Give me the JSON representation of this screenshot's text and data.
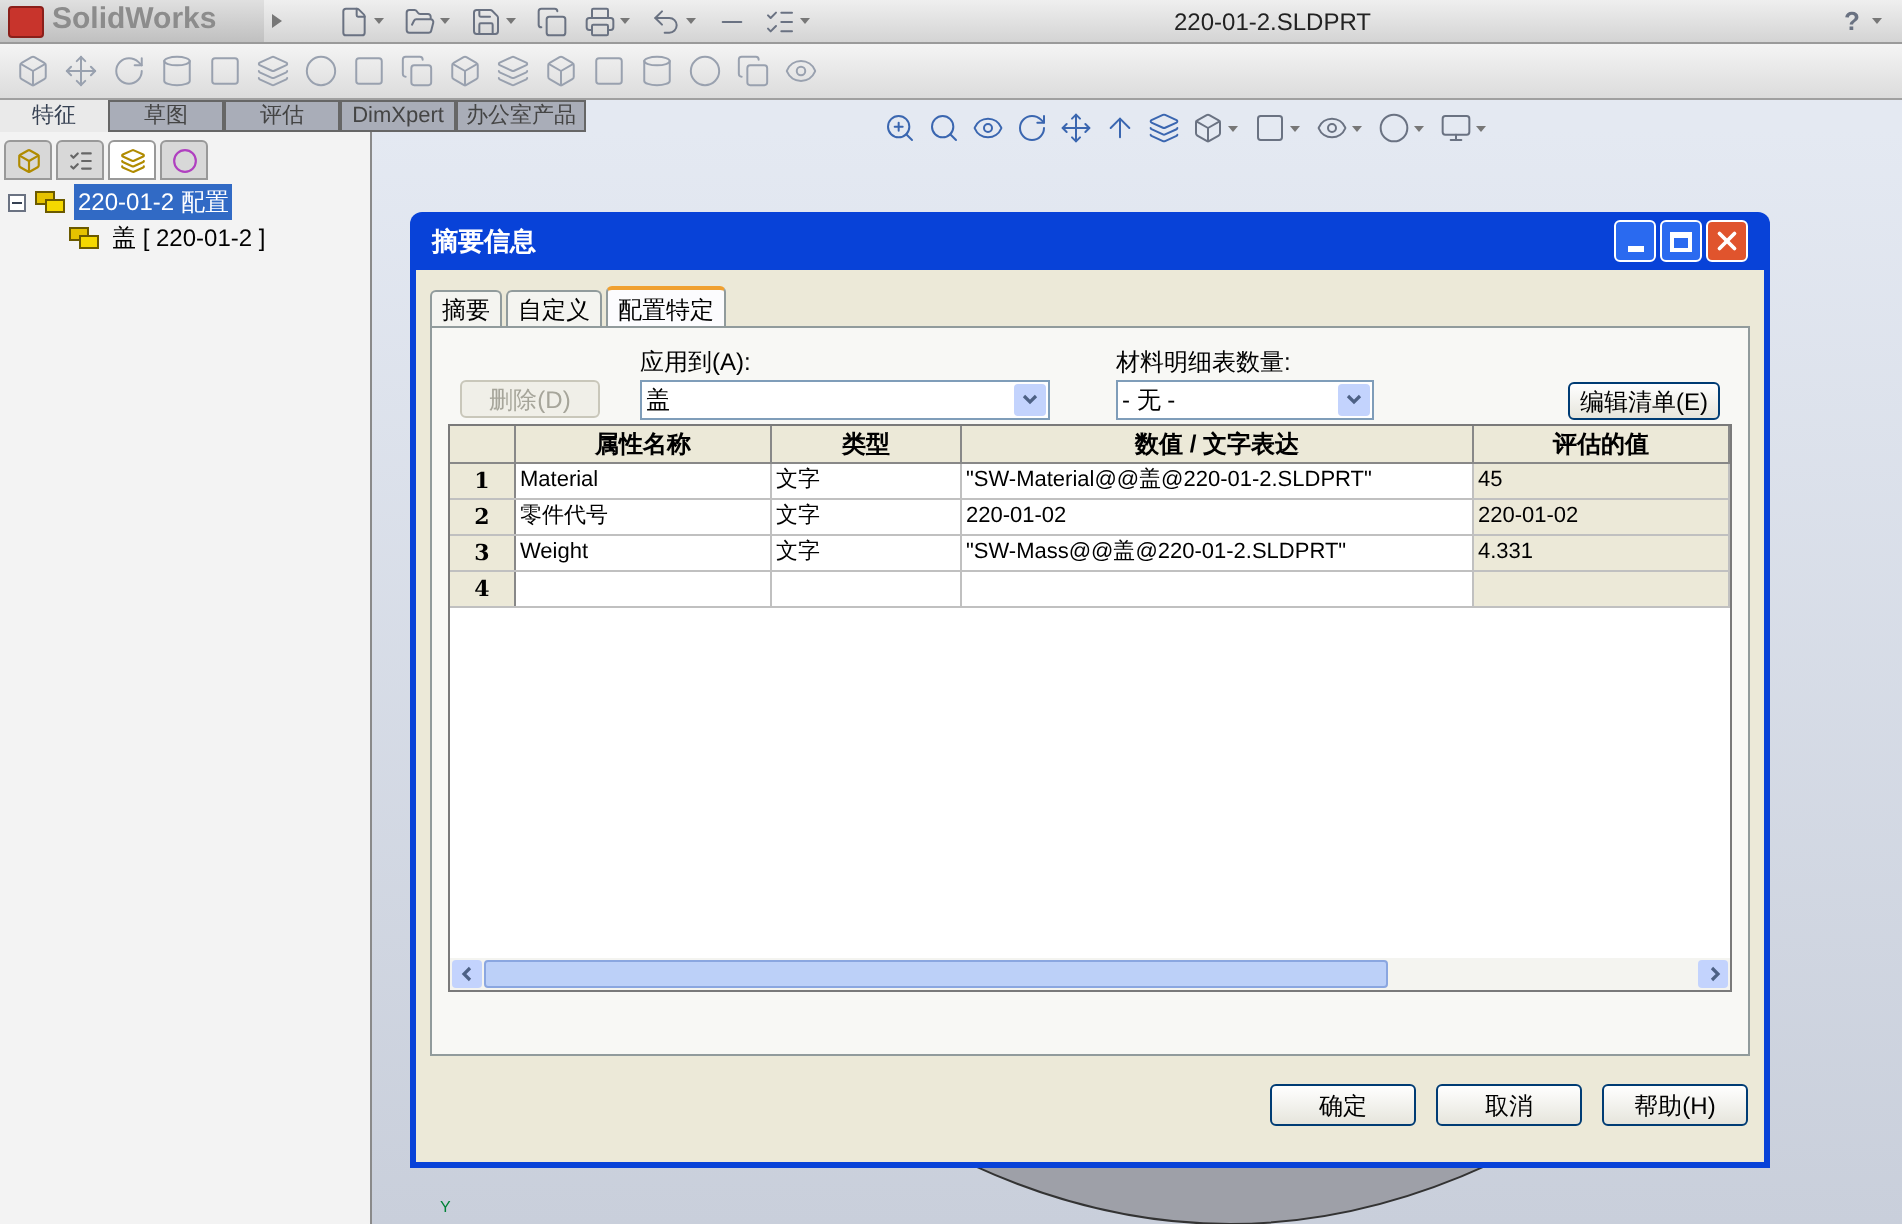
{
  "app": {
    "logo_text": "SolidWorks",
    "document_title": "220-01-2.SLDPRT",
    "help_label": "?"
  },
  "command_tabs": [
    {
      "label": "特征",
      "selected": true
    },
    {
      "label": "草图",
      "selected": false
    },
    {
      "label": "评估",
      "selected": false
    },
    {
      "label": "DimXpert",
      "selected": false
    },
    {
      "label": "办公室产品",
      "selected": false
    }
  ],
  "panel_tabs": [
    {
      "kind": "feature",
      "selected": false
    },
    {
      "kind": "property",
      "selected": false
    },
    {
      "kind": "config",
      "selected": true
    },
    {
      "kind": "display",
      "selected": false
    }
  ],
  "tree": [
    {
      "label": "220-01-2 配置",
      "selected": true,
      "expanded": true,
      "children": [
        {
          "label": "盖 [ 220-01-2 ]",
          "selected": false
        }
      ]
    }
  ],
  "dialog": {
    "title": "摘要信息",
    "tabs": [
      {
        "label": "摘要",
        "selected": false
      },
      {
        "label": "自定义",
        "selected": false
      },
      {
        "label": "配置特定",
        "selected": true
      }
    ],
    "delete_button": {
      "label": "删除(D)",
      "disabled": true
    },
    "apply_to": {
      "label": "应用到(A):",
      "value": "盖"
    },
    "bom_quantity": {
      "label": "材料明细表数量:",
      "value": "- 无 -"
    },
    "edit_list_button": "编辑清单(E)",
    "table": {
      "columns": [
        "属性名称",
        "类型",
        "数值 / 文字表达",
        "评估的值"
      ],
      "rows": [
        {
          "number": "1",
          "cells": [
            "Material",
            "文字",
            "\"SW-Material@@盖@220-01-2.SLDPRT\"",
            "45"
          ]
        },
        {
          "number": "2",
          "cells": [
            "零件代号",
            "文字",
            "220-01-02",
            "220-01-02"
          ]
        },
        {
          "number": "3",
          "cells": [
            "Weight",
            "文字",
            "\"SW-Mass@@盖@220-01-2.SLDPRT\"",
            "4.331"
          ]
        },
        {
          "number": "4",
          "cells": [
            "",
            "",
            "",
            ""
          ]
        }
      ]
    },
    "buttons": [
      "确定",
      "取消",
      "帮助(H)"
    ]
  },
  "triad_label": "Y"
}
